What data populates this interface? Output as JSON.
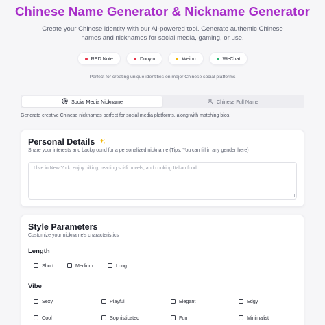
{
  "header": {
    "title": "Chinese Name Generator & Nickname Generator",
    "subtitle": "Create your Chinese identity with our AI-powered tool. Generate authentic Chinese names and nicknames for social media, gaming, or use.",
    "tagline": "Perfect for creating unique identities on major Chinese social platforms"
  },
  "platforms": [
    {
      "label": "RED Note",
      "color": "#e8344a"
    },
    {
      "label": "Douyin",
      "color": "#e8344a"
    },
    {
      "label": "Weibo",
      "color": "#f2b705"
    },
    {
      "label": "WeChat",
      "color": "#2bb673"
    }
  ],
  "tabs": [
    {
      "label": "Social Media Nickname",
      "icon": "at-icon",
      "active": true
    },
    {
      "label": "Chinese Full Name",
      "icon": "user-icon",
      "active": false
    }
  ],
  "tab_description": "Generate creative Chinese nicknames perfect for social media platforms, along with matching bios.",
  "personal": {
    "title": "Personal Details",
    "subtitle": "Share your interests and background for a personalized nickname (Tips: You can fill in any gender here)",
    "placeholder": "I live in New York, enjoy hiking, reading sci-fi novels, and cooking Italian food..."
  },
  "style": {
    "title": "Style Parameters",
    "subtitle": "Customize your nickname's characteristics",
    "length_label": "Length",
    "length_options": [
      "Short",
      "Medium",
      "Long"
    ],
    "vibe_label": "Vibe",
    "vibe_options": [
      "Sexy",
      "Playful",
      "Elegant",
      "Edgy",
      "Cool",
      "Sophisticated",
      "Fun",
      "Minimalist"
    ]
  }
}
